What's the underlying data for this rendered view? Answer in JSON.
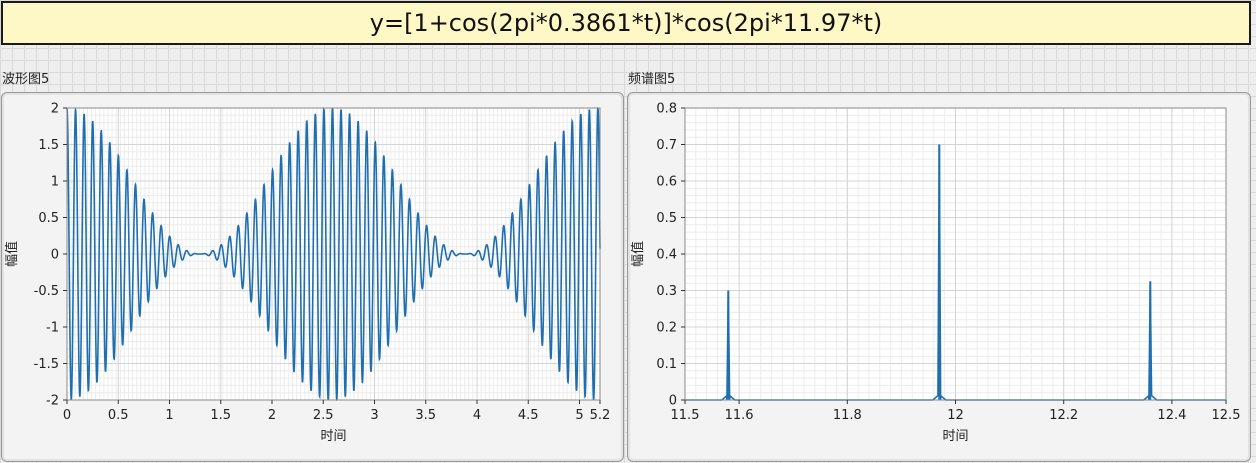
{
  "formula": "y=[1+cos(2pi*0.3861*t)]*cos(2pi*11.97*t)",
  "waveform": {
    "label": "波形图5",
    "chart_data": {
      "type": "line",
      "x_label": "时间",
      "y_label": "幅值",
      "xlim": [
        0,
        5.2
      ],
      "ylim": [
        -2,
        2
      ],
      "x_ticks": [
        "0",
        "0.5",
        "1",
        "1.5",
        "2",
        "2.5",
        "3",
        "3.5",
        "4",
        "4.5",
        "5",
        "5.2"
      ],
      "y_ticks": [
        "-2",
        "-1.5",
        "-1",
        "-0.5",
        "0",
        "0.5",
        "1",
        "1.5",
        "2"
      ],
      "grid": true,
      "series": [
        {
          "color": "#1f6fb0",
          "function": "(1+cos(2*pi*0.3861*t))*cos(2*pi*11.97*t)",
          "carrier_hz": 11.97,
          "modulation_hz": 0.3861,
          "x_range": [
            0,
            5.2
          ]
        }
      ]
    }
  },
  "spectrum": {
    "label": "频谱图5",
    "chart_data": {
      "type": "line",
      "x_label": "时间",
      "y_label": "幅值",
      "xlim": [
        11.5,
        12.5
      ],
      "ylim": [
        0,
        0.8
      ],
      "x_ticks": [
        "11.5",
        "11.6",
        "11.8",
        "12",
        "12.2",
        "12.4",
        "12.5"
      ],
      "y_ticks": [
        "0",
        "0.1",
        "0.2",
        "0.3",
        "0.4",
        "0.5",
        "0.6",
        "0.7",
        "0.8"
      ],
      "grid": true,
      "series": [
        {
          "color": "#1f6fb0",
          "peaks": [
            {
              "x": 11.58,
              "y": 0.3
            },
            {
              "x": 11.97,
              "y": 0.7
            },
            {
              "x": 12.36,
              "y": 0.325
            }
          ]
        }
      ]
    }
  }
}
